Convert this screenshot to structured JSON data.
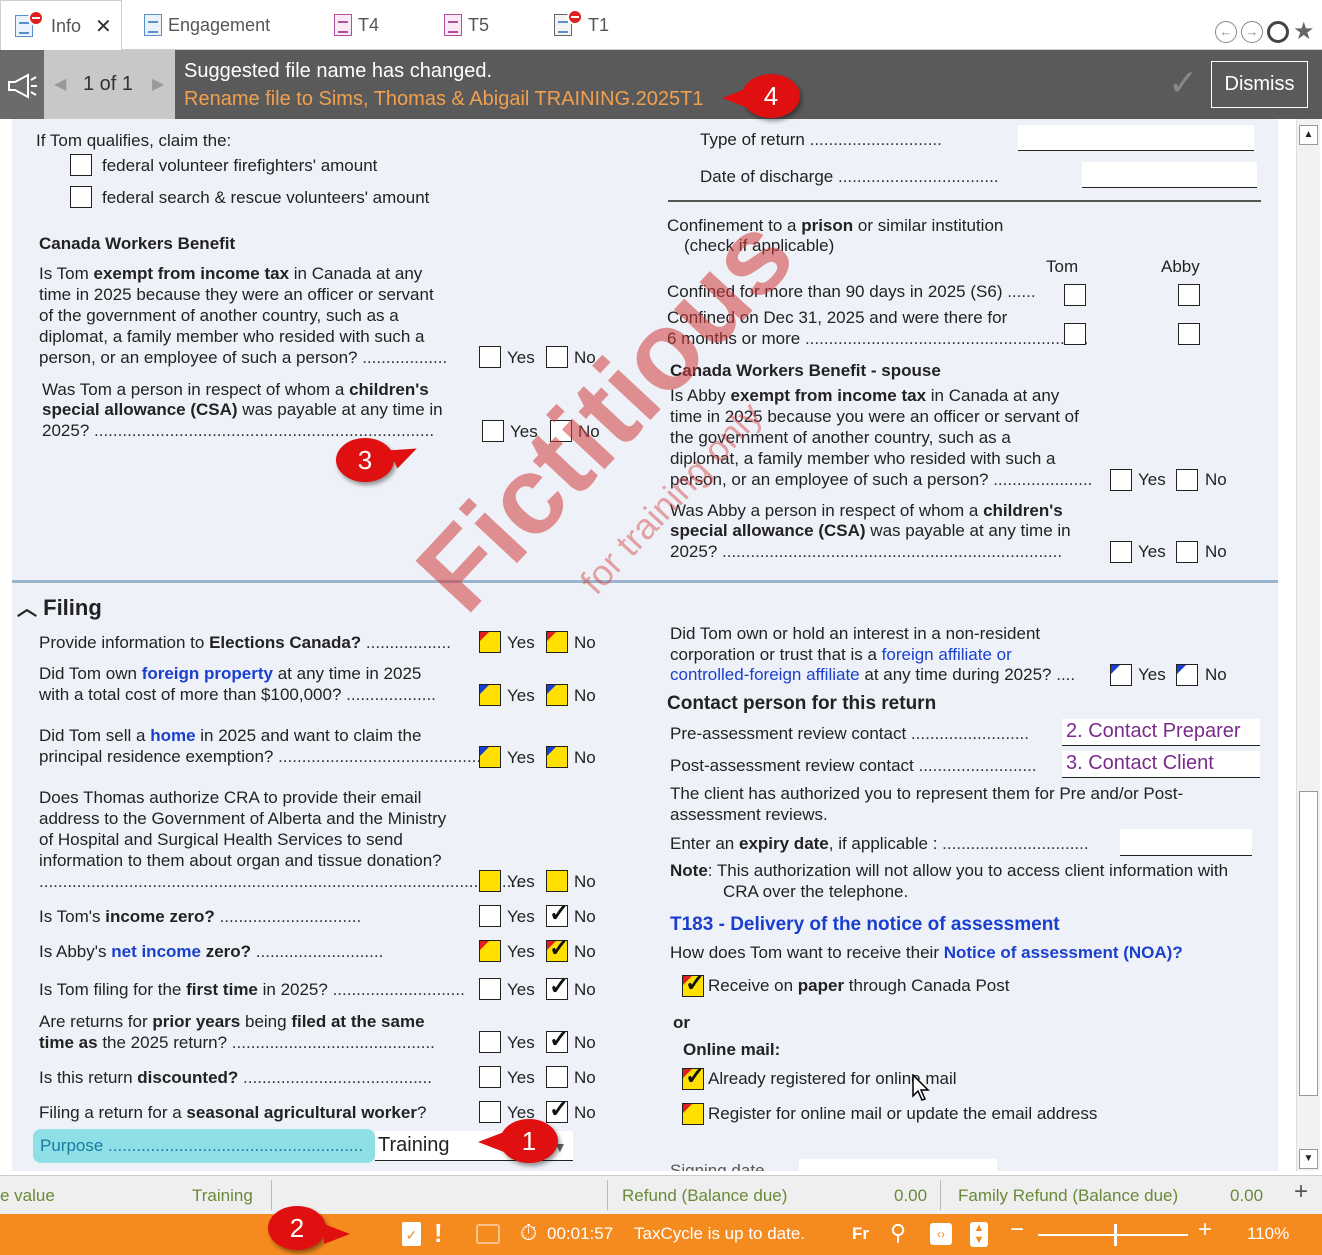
{
  "tabs": [
    {
      "label": "Info"
    },
    {
      "label": "Engagement"
    },
    {
      "label": "T4"
    },
    {
      "label": "T5"
    },
    {
      "label": "T1"
    }
  ],
  "banner": {
    "pager": "1 of 1",
    "message": "Suggested file name has changed.",
    "sub": "Rename file to Sims, Thomas & Abigail TRAINING.2025T1",
    "dismiss": "Dismiss"
  },
  "left": {
    "qualify": "If Tom qualifies, claim the:",
    "ff": "federal volunteer firefighters' amount",
    "sr": "federal search & rescue volunteers' amount",
    "cwb_head": "Canada Workers Benefit",
    "cwb_q": [
      "Is Tom ",
      "exempt from income tax",
      " in Canada at any",
      "time in 2025 because they were an officer or servant",
      "of the government of another country, such as a",
      "diplomat, a family member who resided with such a",
      "person, or an employee of such a person?"
    ],
    "csa_q": [
      "Was Tom a person in respect of whom a ",
      "children's",
      "special allowance (CSA)",
      " was payable at any time in",
      "2025?"
    ]
  },
  "right": {
    "type_return": "Type of return",
    "discharge": "Date of discharge",
    "prison": [
      "Confinement to a ",
      "prison",
      " or similar institution",
      "(check if applicable)"
    ],
    "tom": "Tom",
    "abby": "Abby",
    "conf90": "Confined for more than 90 days in 2025 (S6)",
    "confdec": [
      "Confined on Dec 31, 2025 and were there for",
      "6 months or more"
    ],
    "cwbs_head": "Canada Workers Benefit - spouse",
    "cwbs_q": [
      "Is Abby ",
      "exempt from income tax",
      " in Canada at any",
      "time in 2025 because you were an officer or servant of",
      "the government of another country, such as a",
      "diplomat, a family member who resided with such a",
      "person, or an employee of such a person?"
    ],
    "csas_q": [
      "Was Abby a person in respect of whom a ",
      "children's",
      "special allowance (CSA)",
      " was payable at any time in",
      "2025?"
    ]
  },
  "yes": "Yes",
  "no": "No",
  "filing": {
    "title": "Filing",
    "q1": [
      "Provide information to ",
      "Elections Canada?"
    ],
    "q2": [
      "Did Tom own ",
      "foreign property",
      " at any time in 2025",
      "with a total cost of more than $100,000?"
    ],
    "q3": [
      "Did Tom sell a ",
      "home",
      " in 2025 and want to claim the",
      "principal residence exemption?"
    ],
    "q4": [
      "Does Thomas authorize CRA to provide their email",
      "address to the Government of Alberta and the Ministry",
      "of Hospital and Surgical Health Services to send",
      "information to them about organ and tissue donation?"
    ],
    "q5": [
      "Is Tom's ",
      "income zero?"
    ],
    "q6": [
      "Is Abby's ",
      "net income",
      " zero?"
    ],
    "q7": [
      "Is Tom filing for the ",
      "first time",
      " in 2025?"
    ],
    "q8": [
      "Are returns for ",
      "prior years",
      " being ",
      "filed at the same",
      "time as",
      " the 2025 return?"
    ],
    "q9": [
      "Is this return ",
      "discounted?"
    ],
    "q10": [
      "Filing a return for a ",
      "seasonal agricultural worker",
      "?"
    ],
    "purpose_label": "Purpose",
    "purpose_value": "Training",
    "r1": [
      "Did Tom own or hold an interest in a non-resident",
      "corporation or trust that is a ",
      "foreign affiliate or",
      "controlled-foreign affiliate",
      " at any time during 2025?"
    ],
    "contact_head": "Contact person for this return",
    "pre": "Pre-assessment review contact",
    "pre_val": "2. Contact Preparer",
    "post": "Post-assessment review contact",
    "post_val": "3. Contact Client",
    "auth": [
      "The client has authorized you to represent them for Pre and/or Post-",
      "assessment reviews."
    ],
    "expiry": [
      "Enter an ",
      "expiry date",
      ", if applicable :"
    ],
    "note": [
      "Note",
      ": This authorization will not allow you to access client information with",
      "CRA over the telephone."
    ],
    "t183": "T183 - Delivery of the notice of assessment",
    "noa": [
      "How does Tom want to receive their ",
      "Notice of assessment (NOA)?"
    ],
    "paper": [
      "Receive on ",
      "paper",
      " through Canada Post"
    ],
    "or": "or",
    "online": "Online mail:",
    "reg": "Already registered for online mail",
    "upd": "Register for online mail or update the email address",
    "sign": "Signing date"
  },
  "status1": {
    "v": "e value",
    "training": "Training",
    "refund": "Refund (Balance due)",
    "refund_v": "0.00",
    "family": "Family Refund (Balance due)",
    "family_v": "0.00"
  },
  "status2": {
    "timer": "00:01:57",
    "msg": "TaxCycle is up to date.",
    "lang": "Fr",
    "zoom": "110%"
  },
  "watermark": {
    "big": "Fictitious",
    "small": "for training only"
  },
  "callouts": [
    "1",
    "2",
    "3",
    "4"
  ]
}
